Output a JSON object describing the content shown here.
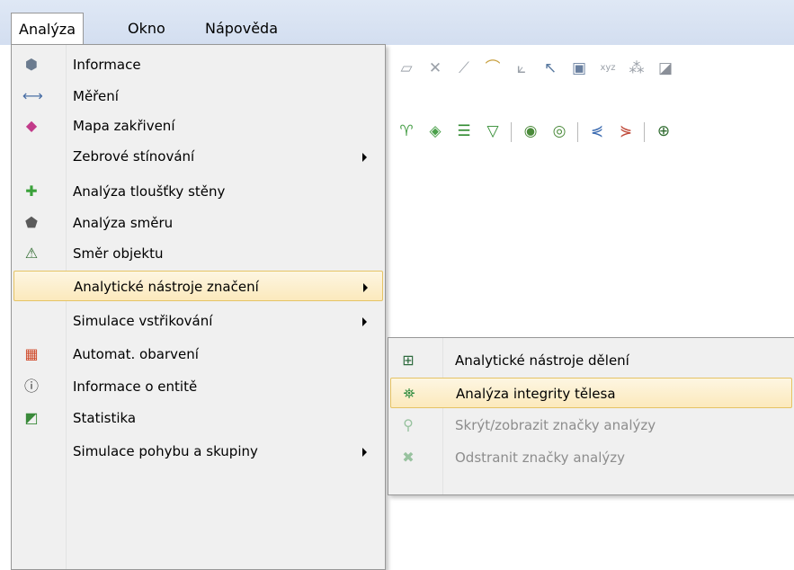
{
  "menubar": {
    "items": [
      {
        "label": "Analýza",
        "active": true
      },
      {
        "label": "Okno",
        "active": false
      },
      {
        "label": "Nápověda",
        "active": false
      }
    ]
  },
  "toolbar_row1_icons": [
    "plane-icon",
    "cross-icon",
    "plane-cross-icon",
    "curve-icon",
    "axis-icon",
    "pointer-icon",
    "frame-icon",
    "xyz-icon",
    "node-icon",
    "shade-icon"
  ],
  "toolbar_row2_icons": [
    "funnel-icon",
    "surface-icon",
    "layers-icon",
    "cup-icon",
    "shell-a-icon",
    "shell-b-icon",
    "branch-a-icon",
    "branch-b-icon",
    "fit-icon"
  ],
  "analyza_menu": {
    "items": [
      {
        "label": "Informace",
        "icon": "info-cube-icon",
        "glyph": "⬢",
        "color": "#6b7b8f",
        "submenu": false
      },
      {
        "label": "Měření",
        "icon": "ruler-icon",
        "glyph": "⟷",
        "color": "#4a6fa5",
        "submenu": false
      },
      {
        "label": "Mapa zakřivení",
        "icon": "curvature-map-icon",
        "glyph": "◆",
        "color": "#c23b8a",
        "submenu": false
      },
      {
        "label": "Zebrové stínování",
        "icon": "",
        "glyph": "",
        "color": "",
        "submenu": true
      },
      {
        "label": "Analýza tloušťky stěny",
        "icon": "wall-thickness-icon",
        "glyph": "✚",
        "color": "#3aa13a",
        "submenu": false
      },
      {
        "label": "Analýza směru",
        "icon": "direction-analysis-icon",
        "glyph": "⬟",
        "color": "#5a5a5a",
        "submenu": false
      },
      {
        "label": "Směr objektu",
        "icon": "object-direction-icon",
        "glyph": "⚠",
        "color": "#2f6b2f",
        "submenu": false
      },
      {
        "label": "Analytické nástroje značení",
        "icon": "",
        "glyph": "",
        "color": "",
        "submenu": true,
        "highlight": true
      },
      {
        "label": "Simulace vstřikování",
        "icon": "",
        "glyph": "",
        "color": "",
        "submenu": true
      },
      {
        "label": "Automat. obarvení",
        "icon": "auto-color-icon",
        "glyph": "▦",
        "color": "#d04a2a",
        "submenu": false
      },
      {
        "label": "Informace o entitě",
        "icon": "entity-info-icon",
        "glyph": "ⓘ",
        "color": "#333333",
        "submenu": false
      },
      {
        "label": "Statistika",
        "icon": "statistics-icon",
        "glyph": "◩",
        "color": "#3a8a3a",
        "submenu": false
      },
      {
        "label": "Simulace pohybu a skupiny",
        "icon": "",
        "glyph": "",
        "color": "",
        "submenu": true
      }
    ]
  },
  "sub_menu": {
    "items": [
      {
        "label": "Analytické nástroje dělení",
        "icon": "split-tools-icon",
        "glyph": "⊞",
        "color": "#2e6b3e",
        "disabled": false,
        "highlight": false
      },
      {
        "label": "Analýza integrity tělesa",
        "icon": "body-integrity-icon",
        "glyph": "⛯",
        "color": "#2e8b3e",
        "disabled": false,
        "highlight": true
      },
      {
        "label": "Skrýt/zobrazit značky analýzy",
        "icon": "toggle-marks-icon",
        "glyph": "⚲",
        "color": "#2e8b3e",
        "disabled": true,
        "highlight": false
      },
      {
        "label": "Odstranit značky analýzy",
        "icon": "remove-marks-icon",
        "glyph": "✖",
        "color": "#2e8b3e",
        "disabled": true,
        "highlight": false
      }
    ]
  },
  "colors": {
    "menu_bg": "#f0f0f0",
    "highlight_border": "#e5c365",
    "menubar_bg": "#d8e3f3"
  }
}
